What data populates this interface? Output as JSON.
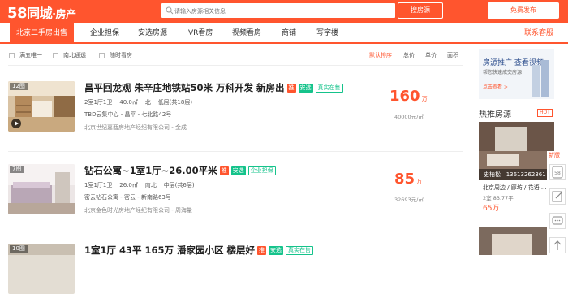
{
  "header": {
    "logo_num": "58",
    "logo_text": "同城",
    "logo_sub": "·房产",
    "search_placeholder": "请输入房源相关信息",
    "search_button": "搜房源",
    "publish_button": "免费发布"
  },
  "nav": {
    "tabs": [
      {
        "label": "北京二手房出售",
        "active": true
      },
      {
        "label": "企业担保"
      },
      {
        "label": "安选房源"
      },
      {
        "label": "VR看房"
      },
      {
        "label": "视频看房"
      },
      {
        "label": "商铺"
      },
      {
        "label": "写字楼"
      }
    ],
    "contact": "联系客服"
  },
  "filters": {
    "checks": [
      "满五唯一",
      "南北通透",
      "随时看房"
    ],
    "sort": [
      "默认排序",
      "总价",
      "单价",
      "面积"
    ]
  },
  "listings": [
    {
      "img_count": "12图",
      "title": "昌平回龙观 朱辛庄地铁站50米 万科开发 新房出",
      "badges": [
        "推",
        "安选",
        "真实在售"
      ],
      "layout": "2室1厅1卫",
      "area": "40.0㎡",
      "orient": "北",
      "floor": "低层(共18层)",
      "location": "TBD云集中心 - 昌平 - 七北路42号",
      "agent": "北京世纪嘉酉房地产经纪有限公司 - 金成",
      "price": "160",
      "price_unit": "万",
      "unit_price": "40000元/㎡"
    },
    {
      "img_count": "7图",
      "title": "钻石公寓~1室1厅~26.00平米",
      "badges": [
        "推",
        "安选",
        "企业担保"
      ],
      "layout": "1室1厅1卫",
      "area": "26.0㎡",
      "orient": "南北",
      "floor": "中层(共6层)",
      "location": "密云钻石公寓 - 密云 - 新南路63号",
      "agent": "北京金色时光房地产经纪有限公司 - 周海量",
      "price": "85",
      "price_unit": "万",
      "unit_price": "32693元/㎡"
    },
    {
      "img_count": "10图",
      "title": "1室1厅 43平 165万 潘家园小区 楼层好",
      "badges": [
        "推",
        "安选",
        "真实在售"
      ]
    }
  ],
  "right": {
    "ad_title": "房源推广  查看视频",
    "ad_sub": "帮您快速成交房源",
    "ad_more": "点击查看 >",
    "hot_title": "热推房源",
    "hot_badge": "HOT",
    "hot_name": "史柏松",
    "hot_phone": "13613262361",
    "hot_loc": "北京周边 / 廊坊 / 花语 ...",
    "hot_spec": "2室    83.77平",
    "hot_price": "65万"
  },
  "sidebar": {
    "label": "新版"
  },
  "colors": {
    "brand": "#ff552e",
    "anxuan": "#15c38b"
  }
}
